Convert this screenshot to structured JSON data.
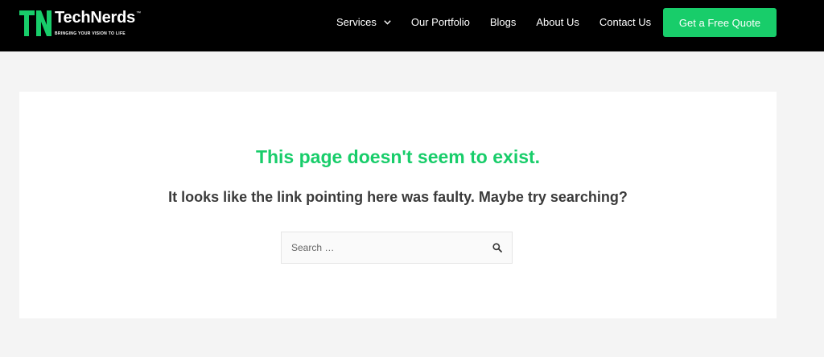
{
  "header": {
    "logo": {
      "name": "TechNerds",
      "trademark": "™",
      "tagline": "BRINGING YOUR VISION TO LIFE",
      "mark_color": "#18cd6a"
    },
    "nav": [
      {
        "label": "Services",
        "has_dropdown": true,
        "icon": "chevron-down-icon"
      },
      {
        "label": "Our Portfolio"
      },
      {
        "label": "Blogs"
      },
      {
        "label": "About Us"
      },
      {
        "label": "Contact Us"
      }
    ],
    "cta_label": "Get a Free Quote"
  },
  "main": {
    "title": "This page doesn't seem to exist.",
    "message": "It looks like the link pointing here was faulty. Maybe try searching?",
    "search": {
      "placeholder": "Search …",
      "value": "",
      "icon": "search-icon"
    }
  },
  "colors": {
    "accent": "#18cd6a",
    "header_bg": "#000000",
    "page_bg": "#f4f4f4",
    "text": "#3a3a3a"
  }
}
